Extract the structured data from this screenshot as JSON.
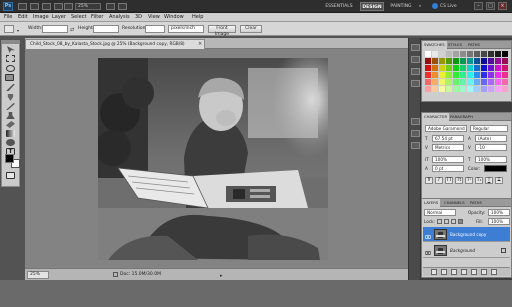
{
  "appbar": {
    "logo": "Ps",
    "zoom": "25%",
    "workspaces": [
      "ESSENTIALS",
      "DESIGN",
      "PAINTING"
    ],
    "active_workspace": "DESIGN",
    "more": "»",
    "cslive": "CS Live",
    "window_controls": [
      "–",
      "□",
      "×"
    ]
  },
  "menu": [
    "File",
    "Edit",
    "Image",
    "Layer",
    "Select",
    "Filter",
    "Analysis",
    "3D",
    "View",
    "Window",
    "Help"
  ],
  "options": {
    "width_label": "Width:",
    "height_label": "Height:",
    "resolution_label": "Resolution:",
    "units": "pixels/inch",
    "front_image": "Front Image",
    "clear": "Clear"
  },
  "document": {
    "tab_title": "Child_Stock_08_by_Kalasta_Stock.jpg @ 25% (Background copy, RGB/8)",
    "close": "×",
    "zoom": "25%",
    "doc_info": "Doc: 15.0M/30.0M"
  },
  "swatches_panel": {
    "tabs": [
      "SWATCHES",
      "STYLES",
      "PATHS"
    ]
  },
  "character_panel": {
    "tabs": [
      "CHARACTER",
      "PARAGRAPH"
    ],
    "font_family": "Adobe Garamond",
    "font_style": "Regular",
    "font_size": "67.54 pt",
    "leading": "(Auto)",
    "kerning": "Metrics",
    "tracking": "-10",
    "vertical_scale": "100%",
    "horizontal_scale": "100%",
    "baseline_shift": "0 pt",
    "color_label": "Color:",
    "language": "English: USA",
    "antialias": "Crisp"
  },
  "layers_panel": {
    "tabs": [
      "LAYERS",
      "CHANNELS",
      "PATHS"
    ],
    "blend_mode": "Normal",
    "opacity_label": "Opacity:",
    "opacity": "100%",
    "lock_label": "Lock:",
    "fill_label": "Fill:",
    "fill": "100%",
    "layers": [
      {
        "name": "Background copy",
        "selected": true
      },
      {
        "name": "Background",
        "selected": false
      }
    ]
  }
}
